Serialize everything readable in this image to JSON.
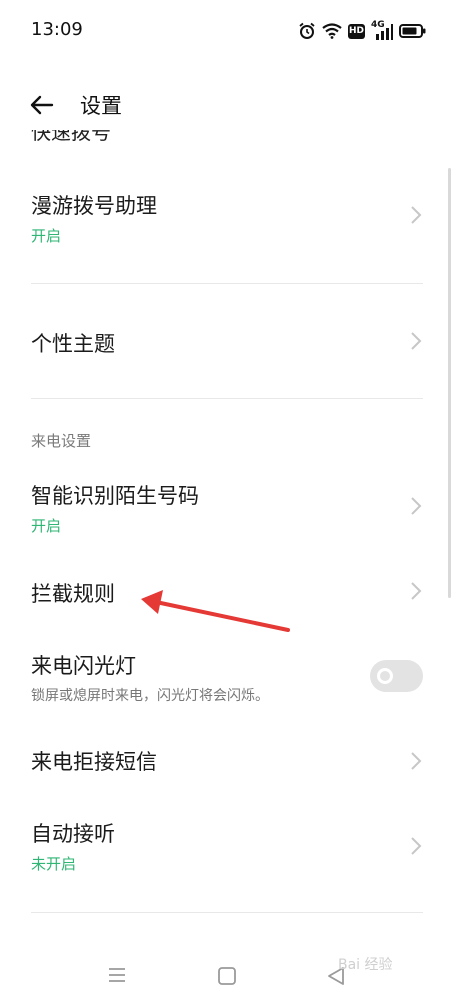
{
  "status_bar": {
    "time": "13:09",
    "icons": [
      "alarm-icon",
      "wifi-icon",
      "hd-icon",
      "signal-4g-icon",
      "battery-icon"
    ],
    "hd_label": "HD",
    "network_label": "4G"
  },
  "header": {
    "title": "设置",
    "back_icon": "back-arrow-icon"
  },
  "clipped_item": {
    "label": "快速拨号"
  },
  "items": [
    {
      "label": "漫游拨号助理",
      "sub": "开启"
    },
    {
      "label": "个性主题"
    },
    {
      "label": "智能识别陌生号码",
      "sub": "开启"
    },
    {
      "label": "拦截规则"
    },
    {
      "label": "来电闪光灯",
      "sub": "锁屏或熄屏时来电，闪光灯将会闪烁。",
      "toggle_on": false
    },
    {
      "label": "来电拒接短信"
    },
    {
      "label": "自动接听",
      "sub": "未开启"
    }
  ],
  "section_header": "来电设置",
  "annotation": {
    "arrow_color": "#e53935"
  },
  "colors": {
    "accent_green": "#2fb574",
    "arrow_red": "#e53935"
  },
  "watermark": "Bai 经验"
}
